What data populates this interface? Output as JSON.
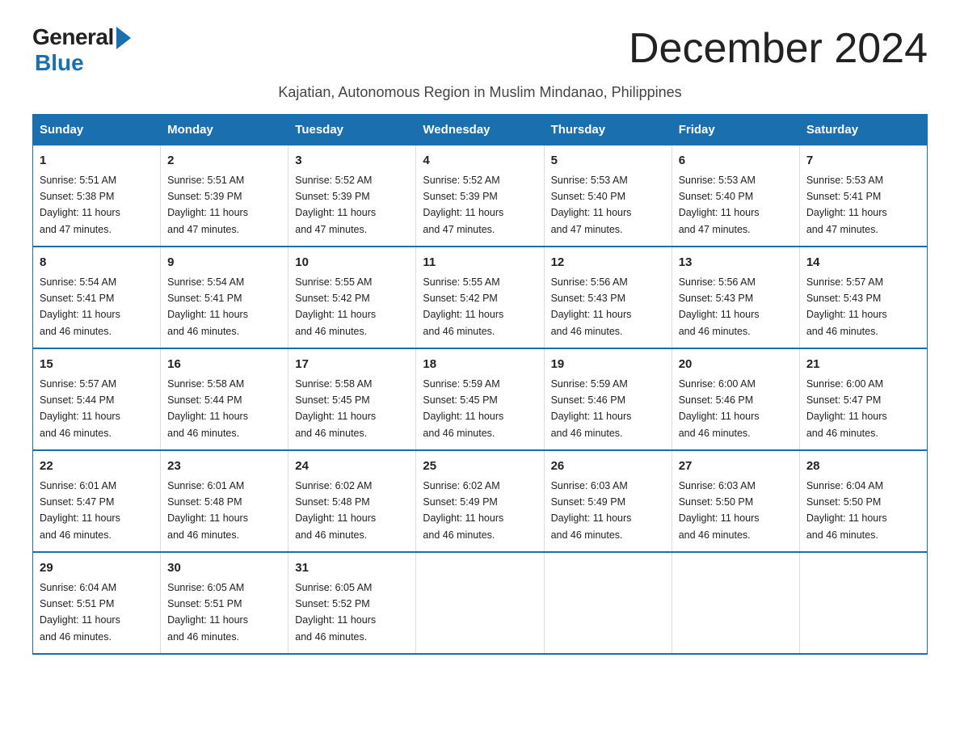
{
  "logo": {
    "general": "General",
    "blue": "Blue"
  },
  "title": "December 2024",
  "subtitle": "Kajatian, Autonomous Region in Muslim Mindanao, Philippines",
  "days_of_week": [
    "Sunday",
    "Monday",
    "Tuesday",
    "Wednesday",
    "Thursday",
    "Friday",
    "Saturday"
  ],
  "weeks": [
    [
      {
        "day": "1",
        "sunrise": "5:51 AM",
        "sunset": "5:38 PM",
        "daylight": "11 hours and 47 minutes."
      },
      {
        "day": "2",
        "sunrise": "5:51 AM",
        "sunset": "5:39 PM",
        "daylight": "11 hours and 47 minutes."
      },
      {
        "day": "3",
        "sunrise": "5:52 AM",
        "sunset": "5:39 PM",
        "daylight": "11 hours and 47 minutes."
      },
      {
        "day": "4",
        "sunrise": "5:52 AM",
        "sunset": "5:39 PM",
        "daylight": "11 hours and 47 minutes."
      },
      {
        "day": "5",
        "sunrise": "5:53 AM",
        "sunset": "5:40 PM",
        "daylight": "11 hours and 47 minutes."
      },
      {
        "day": "6",
        "sunrise": "5:53 AM",
        "sunset": "5:40 PM",
        "daylight": "11 hours and 47 minutes."
      },
      {
        "day": "7",
        "sunrise": "5:53 AM",
        "sunset": "5:41 PM",
        "daylight": "11 hours and 47 minutes."
      }
    ],
    [
      {
        "day": "8",
        "sunrise": "5:54 AM",
        "sunset": "5:41 PM",
        "daylight": "11 hours and 46 minutes."
      },
      {
        "day": "9",
        "sunrise": "5:54 AM",
        "sunset": "5:41 PM",
        "daylight": "11 hours and 46 minutes."
      },
      {
        "day": "10",
        "sunrise": "5:55 AM",
        "sunset": "5:42 PM",
        "daylight": "11 hours and 46 minutes."
      },
      {
        "day": "11",
        "sunrise": "5:55 AM",
        "sunset": "5:42 PM",
        "daylight": "11 hours and 46 minutes."
      },
      {
        "day": "12",
        "sunrise": "5:56 AM",
        "sunset": "5:43 PM",
        "daylight": "11 hours and 46 minutes."
      },
      {
        "day": "13",
        "sunrise": "5:56 AM",
        "sunset": "5:43 PM",
        "daylight": "11 hours and 46 minutes."
      },
      {
        "day": "14",
        "sunrise": "5:57 AM",
        "sunset": "5:43 PM",
        "daylight": "11 hours and 46 minutes."
      }
    ],
    [
      {
        "day": "15",
        "sunrise": "5:57 AM",
        "sunset": "5:44 PM",
        "daylight": "11 hours and 46 minutes."
      },
      {
        "day": "16",
        "sunrise": "5:58 AM",
        "sunset": "5:44 PM",
        "daylight": "11 hours and 46 minutes."
      },
      {
        "day": "17",
        "sunrise": "5:58 AM",
        "sunset": "5:45 PM",
        "daylight": "11 hours and 46 minutes."
      },
      {
        "day": "18",
        "sunrise": "5:59 AM",
        "sunset": "5:45 PM",
        "daylight": "11 hours and 46 minutes."
      },
      {
        "day": "19",
        "sunrise": "5:59 AM",
        "sunset": "5:46 PM",
        "daylight": "11 hours and 46 minutes."
      },
      {
        "day": "20",
        "sunrise": "6:00 AM",
        "sunset": "5:46 PM",
        "daylight": "11 hours and 46 minutes."
      },
      {
        "day": "21",
        "sunrise": "6:00 AM",
        "sunset": "5:47 PM",
        "daylight": "11 hours and 46 minutes."
      }
    ],
    [
      {
        "day": "22",
        "sunrise": "6:01 AM",
        "sunset": "5:47 PM",
        "daylight": "11 hours and 46 minutes."
      },
      {
        "day": "23",
        "sunrise": "6:01 AM",
        "sunset": "5:48 PM",
        "daylight": "11 hours and 46 minutes."
      },
      {
        "day": "24",
        "sunrise": "6:02 AM",
        "sunset": "5:48 PM",
        "daylight": "11 hours and 46 minutes."
      },
      {
        "day": "25",
        "sunrise": "6:02 AM",
        "sunset": "5:49 PM",
        "daylight": "11 hours and 46 minutes."
      },
      {
        "day": "26",
        "sunrise": "6:03 AM",
        "sunset": "5:49 PM",
        "daylight": "11 hours and 46 minutes."
      },
      {
        "day": "27",
        "sunrise": "6:03 AM",
        "sunset": "5:50 PM",
        "daylight": "11 hours and 46 minutes."
      },
      {
        "day": "28",
        "sunrise": "6:04 AM",
        "sunset": "5:50 PM",
        "daylight": "11 hours and 46 minutes."
      }
    ],
    [
      {
        "day": "29",
        "sunrise": "6:04 AM",
        "sunset": "5:51 PM",
        "daylight": "11 hours and 46 minutes."
      },
      {
        "day": "30",
        "sunrise": "6:05 AM",
        "sunset": "5:51 PM",
        "daylight": "11 hours and 46 minutes."
      },
      {
        "day": "31",
        "sunrise": "6:05 AM",
        "sunset": "5:52 PM",
        "daylight": "11 hours and 46 minutes."
      },
      null,
      null,
      null,
      null
    ]
  ],
  "labels": {
    "sunrise": "Sunrise:",
    "sunset": "Sunset:",
    "daylight": "Daylight:"
  }
}
